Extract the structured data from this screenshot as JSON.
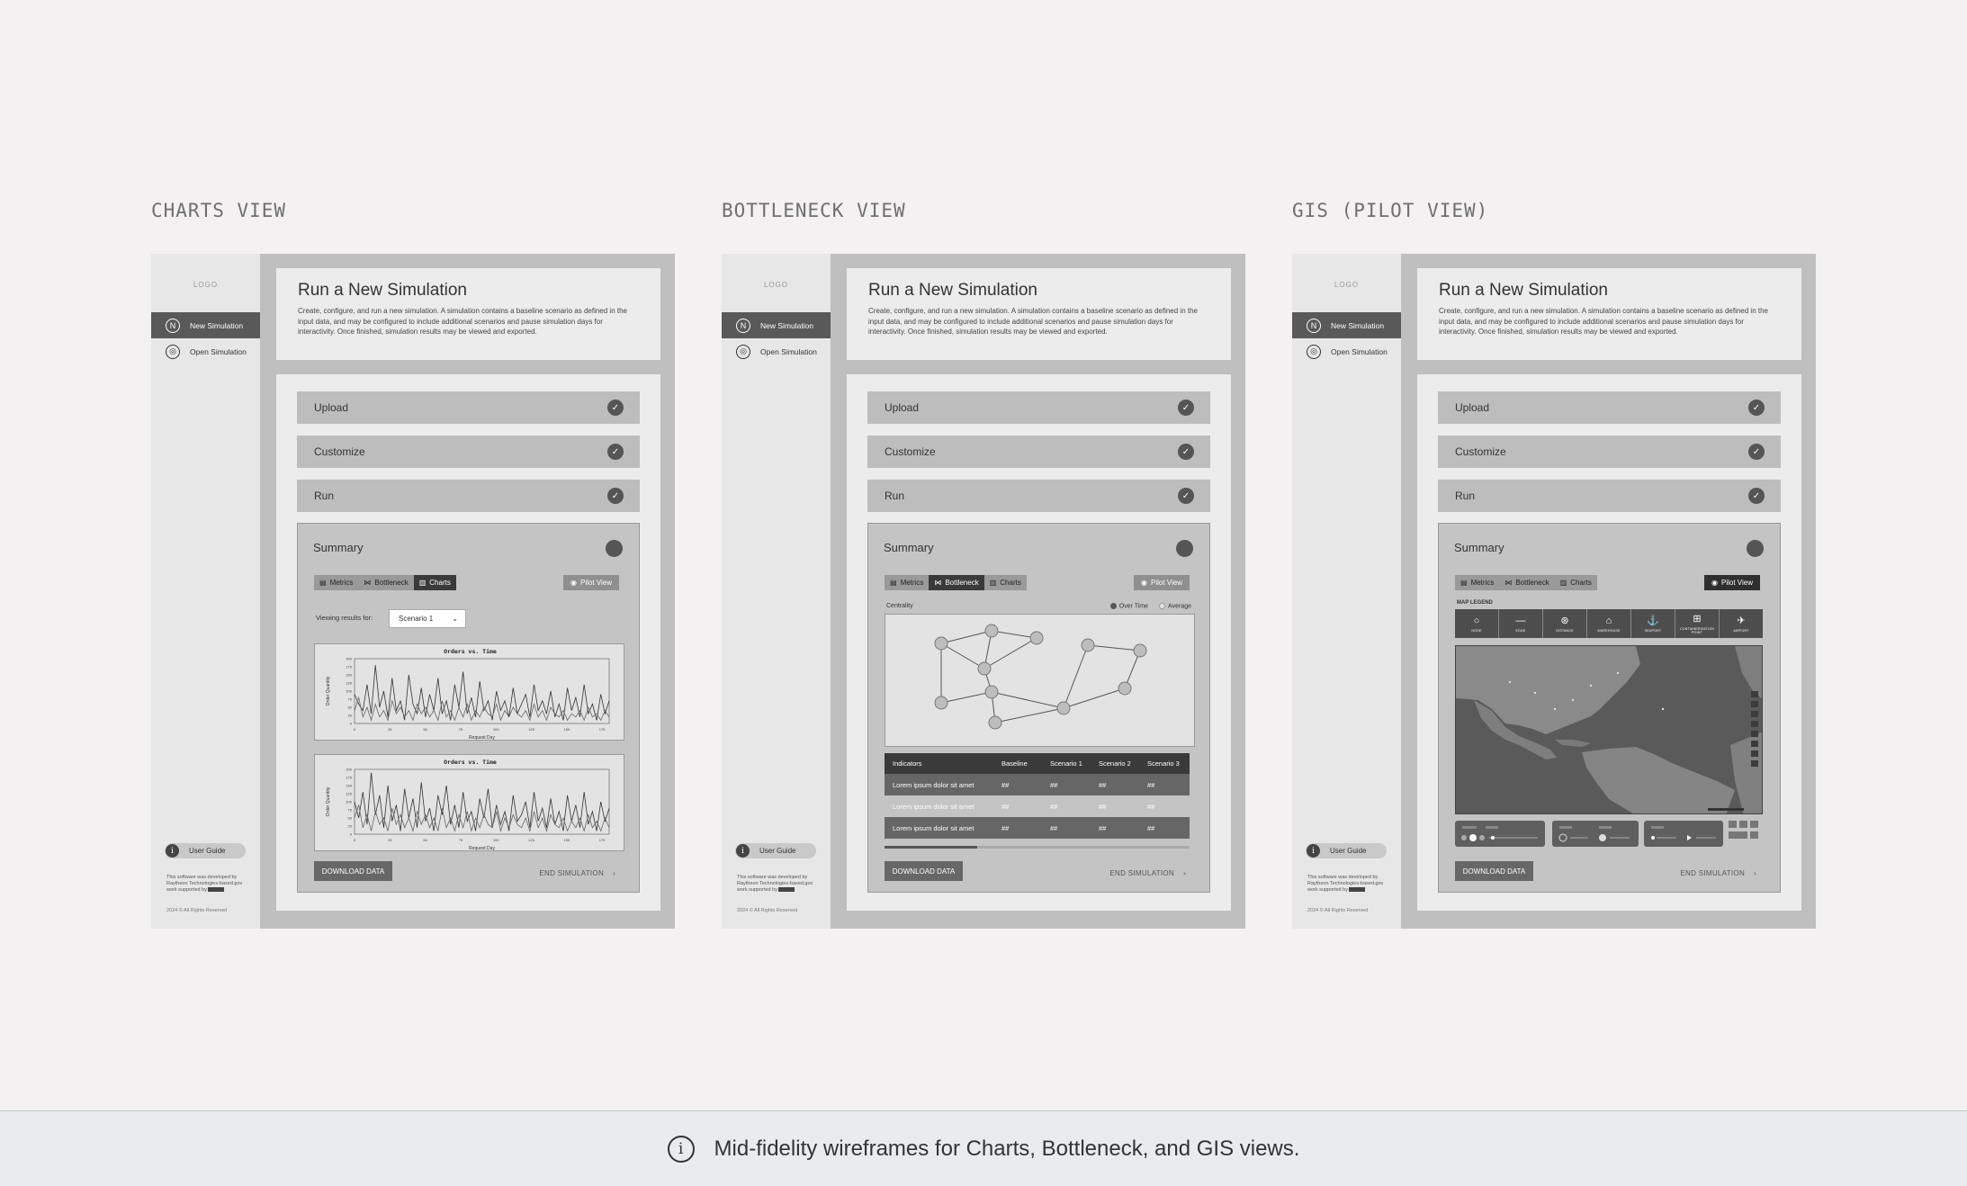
{
  "views": [
    {
      "title": "CHARTS VIEW",
      "variant": "charts",
      "active_tab": "Charts",
      "viewing_label": "Viewing results for:",
      "scenario_value": "Scenario 1",
      "charts": [
        {
          "title": "Orders vs. Time",
          "xlabel": "Request Day",
          "ylabel": "Order Quantity"
        },
        {
          "title": "Orders vs. Time",
          "xlabel": "Request Day",
          "ylabel": "Order Quantity"
        }
      ]
    },
    {
      "title": "BOTTLENECK VIEW",
      "variant": "bottleneck",
      "active_tab": "Bottleneck",
      "centrality_label": "Centrality",
      "legend_over_time": "Over Time",
      "legend_average": "Average",
      "table": {
        "headers": [
          "Indicators",
          "Baseline",
          "Scenario 1",
          "Scenario 2",
          "Scenario 3"
        ],
        "rows": [
          [
            "Lorem ipsum dolor sit amet",
            "##",
            "##",
            "##",
            "##"
          ],
          [
            "Lorem ipsum dolor sit amet",
            "##",
            "##",
            "##",
            "##"
          ],
          [
            "Lorem ipsum dolor sit amet",
            "##",
            "##",
            "##",
            "##"
          ]
        ]
      }
    },
    {
      "title": "GIS (PILOT VIEW)",
      "variant": "gis",
      "active_tab": "Pilot View",
      "map_legend_title": "MAP LEGEND",
      "legend_items": [
        "NODE",
        "EDGE",
        "DISTANCE",
        "WAREHOUSE",
        "SEAPORT",
        "CONTAINERIZATION POINT",
        "AIRPORT"
      ],
      "legend_icons": [
        "○",
        "—",
        "⊛",
        "⌂",
        "⚓",
        "⊞",
        "✈"
      ]
    }
  ],
  "common": {
    "logo": "LOGO",
    "nav": [
      {
        "label": "New Simulation",
        "icon": "N"
      },
      {
        "label": "Open Simulation",
        "icon": "◎"
      }
    ],
    "user_guide": "User Guide",
    "credit": "This software was developed by Raytheon Technologies-based.gov work supported by",
    "copyright": "2024 © All Rights Reserved",
    "header_title": "Run a New Simulation",
    "header_desc": "Create, configure, and run a new simulation. A simulation contains a baseline scenario as defined in the input data, and may be configured to include additional scenarios and pause simulation days for interactivity. Once finished, simulation results may be viewed and exported.",
    "steps": [
      "Upload",
      "Customize",
      "Run"
    ],
    "check_icon": "✓",
    "summary_title": "Summary",
    "tabs": [
      {
        "label": "Metrics",
        "icon": "▤"
      },
      {
        "label": "Bottleneck",
        "icon": "⋈"
      },
      {
        "label": "Charts",
        "icon": "▥"
      }
    ],
    "pilot_view": "Pilot View",
    "pilot_icon": "◉",
    "download": "DOWNLOAD DATA",
    "end_sim": "END SIMULATION",
    "chevron": "›"
  },
  "chart_data": [
    {
      "type": "line",
      "title": "Orders vs. Time",
      "xlabel": "Request Day",
      "ylabel": "Order Quantity",
      "x_ticks": [
        0,
        25,
        50,
        75,
        100,
        125,
        150,
        175
      ],
      "y_ticks": [
        0,
        25,
        50,
        75,
        100,
        125,
        150,
        175,
        200
      ],
      "ylim": [
        0,
        200
      ],
      "xlim": [
        0,
        180
      ],
      "series": [
        {
          "values": [
            90,
            60,
            40,
            120,
            30,
            180,
            50,
            100,
            20,
            140,
            40,
            70,
            10,
            150,
            60,
            30,
            110,
            20,
            90,
            40,
            140,
            30,
            70,
            10,
            120,
            50,
            160,
            30,
            80,
            20,
            130,
            40,
            70,
            10,
            100,
            40,
            70,
            20,
            110,
            30,
            60,
            90,
            20,
            120,
            40,
            70,
            30,
            100,
            20,
            60,
            10,
            110,
            40,
            80,
            20,
            120,
            30,
            60,
            10,
            90,
            30,
            70
          ]
        },
        {
          "values": [
            40,
            80,
            20,
            50,
            10,
            60,
            20,
            40,
            10,
            70,
            30,
            50,
            20,
            40,
            10,
            60,
            30,
            50,
            20,
            40,
            10,
            70,
            20,
            40,
            10,
            50,
            20,
            60,
            10,
            40,
            20,
            50,
            30,
            20,
            60,
            10,
            40,
            20,
            50,
            30,
            20,
            40,
            10,
            60,
            20,
            40,
            10,
            50,
            30,
            20,
            40,
            10,
            30,
            20,
            40,
            10,
            50,
            20,
            30,
            10,
            40,
            20
          ]
        }
      ]
    },
    {
      "type": "line",
      "title": "Orders vs. Time",
      "xlabel": "Request Day",
      "ylabel": "Order Quantity",
      "x_ticks": [
        0,
        25,
        50,
        75,
        100,
        125,
        150,
        175
      ],
      "y_ticks": [
        0,
        25,
        50,
        75,
        100,
        125,
        150,
        175,
        200
      ],
      "ylim": [
        0,
        200
      ],
      "xlim": [
        0,
        180
      ],
      "series": [
        {
          "values": [
            100,
            50,
            130,
            30,
            190,
            60,
            120,
            20,
            150,
            40,
            90,
            10,
            140,
            50,
            110,
            20,
            160,
            40,
            80,
            10,
            120,
            60,
            150,
            30,
            90,
            20,
            130,
            40,
            70,
            10,
            110,
            50,
            140,
            20,
            90,
            30,
            70,
            10,
            120,
            40,
            60,
            100,
            20,
            130,
            40,
            80,
            20,
            110,
            30,
            70,
            10,
            120,
            40,
            90,
            20,
            130,
            30,
            70,
            10,
            100,
            40,
            80
          ]
        },
        {
          "values": [
            50,
            90,
            20,
            60,
            10,
            70,
            30,
            50,
            10,
            80,
            30,
            60,
            20,
            50,
            10,
            70,
            30,
            60,
            20,
            50,
            10,
            80,
            20,
            50,
            10,
            60,
            20,
            70,
            10,
            50,
            20,
            60,
            30,
            20,
            70,
            10,
            50,
            20,
            60,
            30,
            20,
            50,
            10,
            70,
            20,
            50,
            10,
            60,
            30,
            20,
            50,
            10,
            40,
            20,
            50,
            10,
            60,
            20,
            40,
            10,
            50,
            20
          ]
        }
      ]
    }
  ],
  "footer": {
    "icon": "info-icon",
    "caption": "Mid-fidelity wireframes for Charts, Bottleneck, and GIS views."
  }
}
